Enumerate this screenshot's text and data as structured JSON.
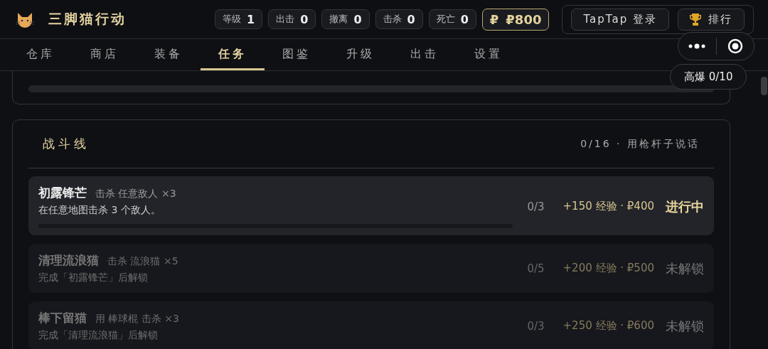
{
  "app": {
    "title": "三脚猫行动"
  },
  "stats": [
    {
      "label": "等级",
      "value": "1"
    },
    {
      "label": "出击",
      "value": "0"
    },
    {
      "label": "撤离",
      "value": "0"
    },
    {
      "label": "击杀",
      "value": "0"
    },
    {
      "label": "死亡",
      "value": "0"
    }
  ],
  "currency": {
    "icon": "₽",
    "value": "₽800"
  },
  "header_buttons": [
    {
      "kind": "login",
      "label": "TapTap 登录"
    },
    {
      "kind": "rank",
      "label": "排行"
    }
  ],
  "tabs": [
    {
      "label": "仓库",
      "selected": false
    },
    {
      "label": "商店",
      "selected": false
    },
    {
      "label": "装备",
      "selected": false
    },
    {
      "label": "任务",
      "selected": true
    },
    {
      "label": "图鉴",
      "selected": false
    },
    {
      "label": "升级",
      "selected": false
    },
    {
      "label": "出击",
      "selected": false
    },
    {
      "label": "设置",
      "selected": false
    }
  ],
  "drop_counter": {
    "label": "高爆 0/10"
  },
  "questline": {
    "title": "战斗线",
    "summary": "0/16 · 用枪杆子说话",
    "quests": [
      {
        "kind": "active",
        "name": "初露锋芒",
        "goal": "击杀 任意敌人 ×3",
        "desc": "在任意地图击杀 3 个敌人。",
        "progress": "0/3",
        "reward": "+150 经验 · ₽400",
        "state_label": "进行中"
      },
      {
        "kind": "locked",
        "name": "清理流浪猫",
        "goal": "击杀 流浪猫 ×5",
        "desc": "完成「初露锋芒」后解锁",
        "progress": "0/5",
        "reward": "+200 经验 · ₽500",
        "state_label": "未解锁"
      },
      {
        "kind": "locked",
        "name": "棒下留猫",
        "goal": "用 棒球棍 击杀 ×3",
        "desc": "完成「清理流浪猫」后解锁",
        "progress": "0/3",
        "reward": "+250 经验 · ₽600",
        "state_label": "未解锁"
      }
    ]
  }
}
